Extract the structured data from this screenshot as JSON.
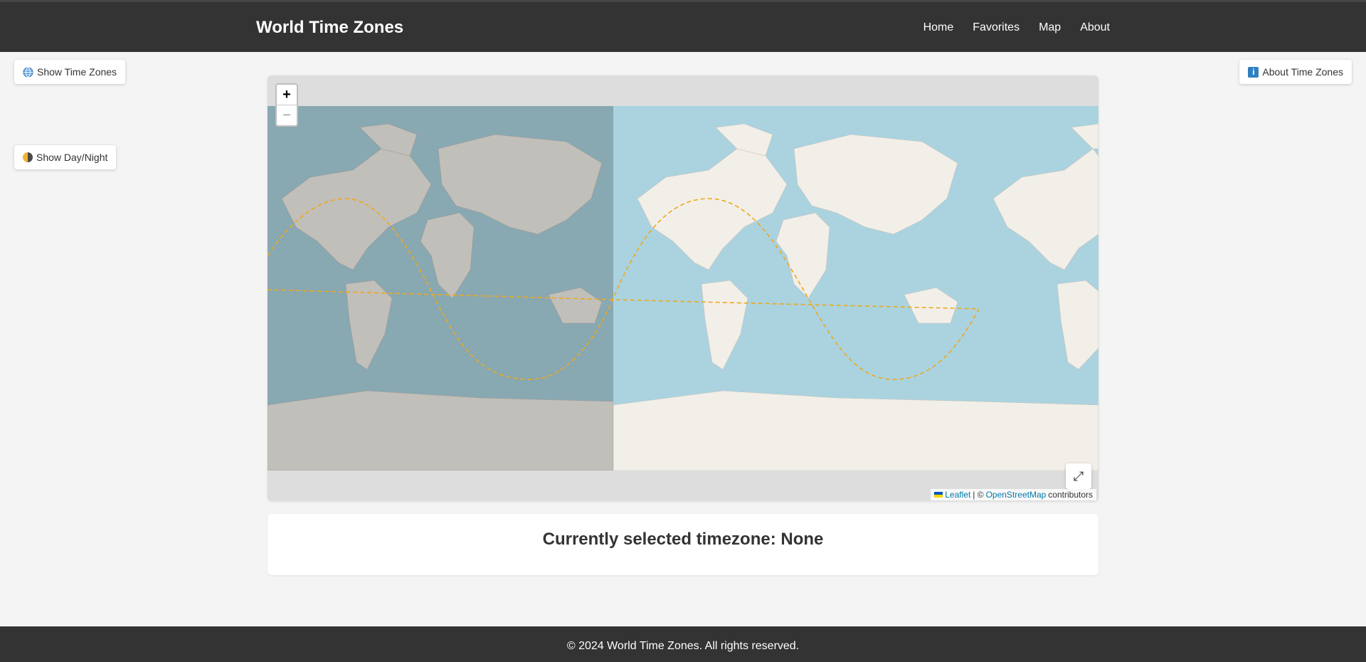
{
  "header": {
    "title": "World Time Zones",
    "nav": [
      "Home",
      "Favorites",
      "Map",
      "About"
    ]
  },
  "controls": {
    "show_time_zones": "Show Time Zones",
    "show_day_night": "Show Day/Night",
    "about_time_zones": "About Time Zones"
  },
  "map": {
    "zoom_in": "+",
    "zoom_out": "−",
    "fullscreen": "⤢",
    "attribution": {
      "leaflet": "Leaflet",
      "separator": "| ©",
      "osm": "OpenStreetMap",
      "suffix": "contributors"
    },
    "colors": {
      "ocean": "#aad3df",
      "land": "#f2efe9",
      "night_overlay": "#000000",
      "terminator_line": "#f0a818"
    }
  },
  "selection": {
    "text": "Currently selected timezone: None"
  },
  "footer": {
    "text": "© 2024 World Time Zones. All rights reserved."
  }
}
